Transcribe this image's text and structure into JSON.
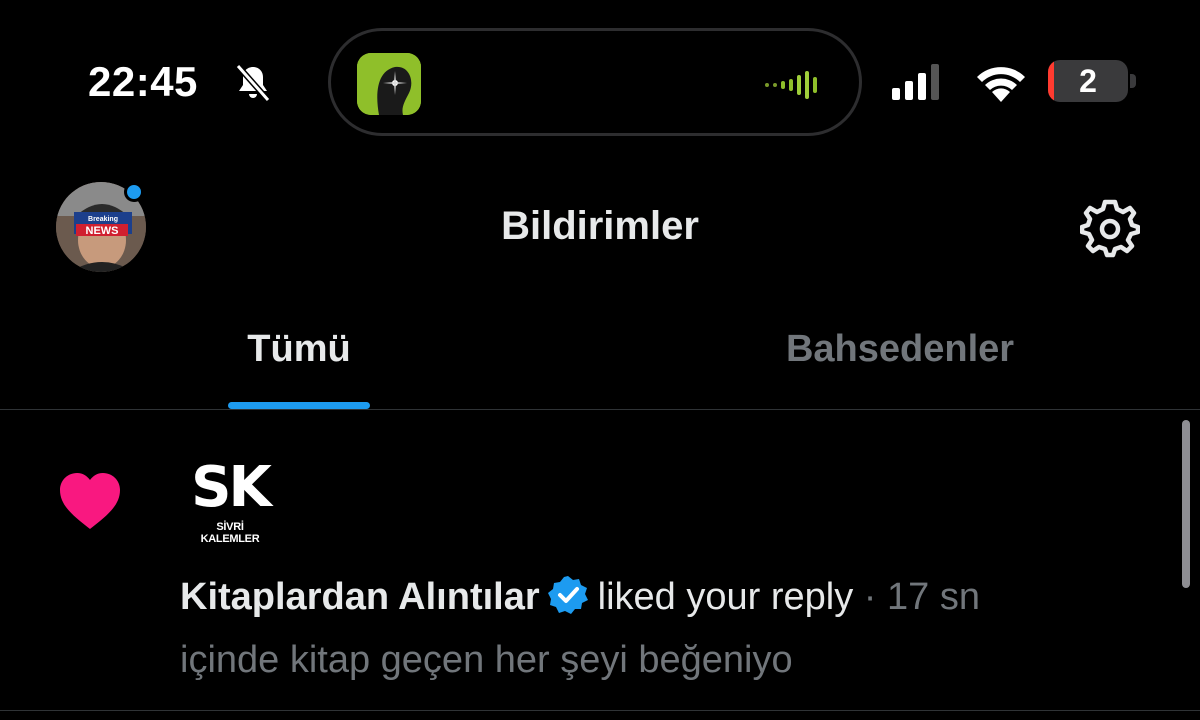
{
  "status_bar": {
    "time": "22:45",
    "battery_level": "2",
    "battery_fraction": 0.08,
    "icons": [
      "bell-slash-icon",
      "signal-icon",
      "wifi-icon",
      "battery-icon"
    ]
  },
  "header": {
    "title": "Bildirimler",
    "avatar_badge_text": "NEWS",
    "avatar_badge_small": "Breaking"
  },
  "tabs": [
    {
      "label": "Tümü",
      "active": true
    },
    {
      "label": "Bahsedenler",
      "active": false
    }
  ],
  "notification": {
    "type_icon": "heart-icon",
    "avatar_logo": "SK",
    "avatar_logo_sub": "SİVRİ KALEMLER",
    "user_name": "Kitaplardan Alıntılar",
    "verified": true,
    "action": "liked your reply",
    "separator": "·",
    "time_ago": "17 sn",
    "preview": "içinde kitap geçen her şeyi beğeniyo"
  },
  "colors": {
    "accent": "#1d9bf0",
    "like": "#f91880",
    "muted": "#71767b"
  }
}
